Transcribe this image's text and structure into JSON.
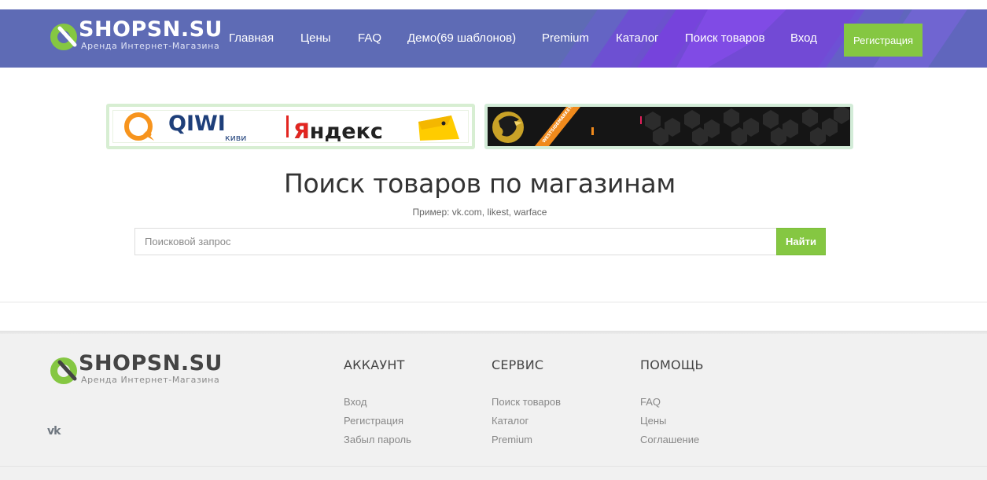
{
  "header": {
    "logo": {
      "name": "SHOPSN.SU",
      "tagline": "Аренда Интернет-Магазина"
    },
    "nav": [
      {
        "label": "Главная"
      },
      {
        "label": "Цены"
      },
      {
        "label": "FAQ"
      },
      {
        "label": "Демо(69 шаблонов)"
      },
      {
        "label": "Premium"
      },
      {
        "label": "Каталог"
      },
      {
        "label": "Поиск товаров"
      },
      {
        "label": "Вход"
      }
    ],
    "register_label": "Регистрация"
  },
  "banners": {
    "qiwi": {
      "main": "QIWI",
      "sub": "киви",
      "yandex": "Яндекс"
    },
    "wsm": {
      "site": "WESTSIDEMARKET.COM"
    }
  },
  "search": {
    "title": "Поиск товаров по магазинам",
    "hint": "Пример: vk.com, likest, warface",
    "placeholder": "Поисковой запрос",
    "button_label": "Найти"
  },
  "footer": {
    "logo": {
      "name": "SHOPSN.SU",
      "tagline": "Аренда Интернет-Магазина"
    },
    "social_icon": "vk-icon",
    "social_text": "vk",
    "columns": [
      {
        "title": "АККАУНТ",
        "links": [
          "Вход",
          "Регистрация",
          "Забыл пароль"
        ]
      },
      {
        "title": "СЕРВИС",
        "links": [
          "Поиск товаров",
          "Каталог",
          "Premium"
        ]
      },
      {
        "title": "ПОМОЩЬ",
        "links": [
          "FAQ",
          "Цены",
          "Соглашение"
        ]
      }
    ]
  },
  "colors": {
    "header_bg": "#5e6bb5",
    "accent_green": "#85c742",
    "deco_purple": "#7a3fe0",
    "footer_bg": "#f1f1f1"
  }
}
